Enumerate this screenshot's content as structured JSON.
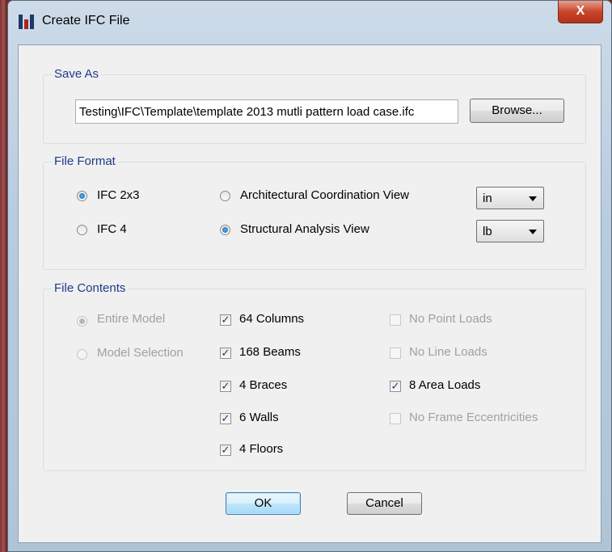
{
  "window": {
    "title": "Create IFC File",
    "close_label": "X"
  },
  "save_as": {
    "group_label": "Save As",
    "path_value": "Testing\\IFC\\Template\\template 2013 mutli pattern load case.ifc",
    "browse_label": "Browse..."
  },
  "file_format": {
    "group_label": "File Format",
    "versions": [
      {
        "label": "IFC 2x3",
        "selected": true
      },
      {
        "label": "IFC 4",
        "selected": false
      }
    ],
    "views": [
      {
        "label": "Architectural Coordination View",
        "selected": false
      },
      {
        "label": "Structural Analysis View",
        "selected": true
      }
    ],
    "length_unit": "in",
    "force_unit": "lb"
  },
  "file_contents": {
    "group_label": "File Contents",
    "scope": [
      {
        "label": "Entire Model",
        "selected": true,
        "enabled": false
      },
      {
        "label": "Model Selection",
        "selected": false,
        "enabled": false
      }
    ],
    "objects": [
      {
        "label": "64 Columns",
        "checked": true
      },
      {
        "label": "168 Beams",
        "checked": true
      },
      {
        "label": "4 Braces",
        "checked": true
      },
      {
        "label": "6 Walls",
        "checked": true
      },
      {
        "label": "4 Floors",
        "checked": true
      }
    ],
    "loads": [
      {
        "label": "No Point Loads",
        "checked": false,
        "enabled": false
      },
      {
        "label": "No Line Loads",
        "checked": false,
        "enabled": false
      },
      {
        "label": "8 Area Loads",
        "checked": true,
        "enabled": true
      },
      {
        "label": "No Frame Eccentricities",
        "checked": false,
        "enabled": false
      }
    ]
  },
  "buttons": {
    "ok_label": "OK",
    "cancel_label": "Cancel"
  },
  "check_glyph": "✓"
}
